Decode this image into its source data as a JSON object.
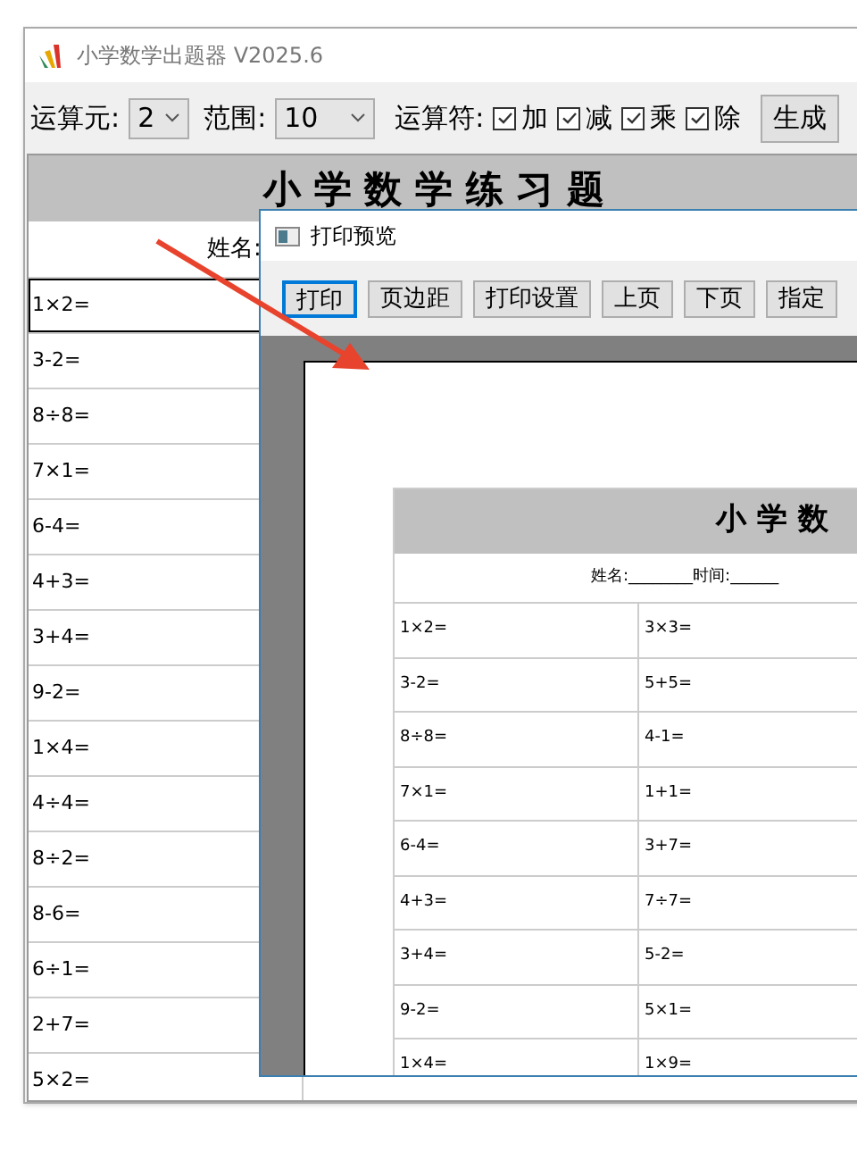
{
  "window": {
    "title": "小学数学出题器 V2025.6"
  },
  "toolbar": {
    "operand_count": {
      "label": "运算元:",
      "value": "2"
    },
    "range": {
      "label": "范围:",
      "value": "10"
    },
    "operators_label": "运算符:",
    "operators": [
      {
        "label": "加",
        "checked": true
      },
      {
        "label": "减",
        "checked": true
      },
      {
        "label": "乘",
        "checked": true
      },
      {
        "label": "除",
        "checked": true
      }
    ],
    "generate_button": "生成"
  },
  "sheet": {
    "title": "小 学 数 学 练 习 题",
    "name_label": "姓名:",
    "rows": [
      {
        "selected": true,
        "cells": [
          "1×2="
        ]
      },
      {
        "selected": false,
        "cells": [
          "3-2="
        ]
      },
      {
        "selected": false,
        "cells": [
          "8÷8="
        ]
      },
      {
        "selected": false,
        "cells": [
          "7×1="
        ]
      },
      {
        "selected": false,
        "cells": [
          "6-4="
        ]
      },
      {
        "selected": false,
        "cells": [
          "4+3="
        ]
      },
      {
        "selected": false,
        "cells": [
          "3+4="
        ]
      },
      {
        "selected": false,
        "cells": [
          "9-2="
        ]
      },
      {
        "selected": false,
        "cells": [
          "1×4="
        ]
      },
      {
        "selected": false,
        "cells": [
          "4÷4="
        ]
      },
      {
        "selected": false,
        "cells": [
          "8÷2="
        ]
      },
      {
        "selected": false,
        "cells": [
          "8-6="
        ]
      },
      {
        "selected": false,
        "cells": [
          "6÷1="
        ]
      },
      {
        "selected": false,
        "cells": [
          "2+7="
        ]
      },
      {
        "selected": false,
        "cells": [
          "5×2="
        ]
      }
    ]
  },
  "print_preview": {
    "title": "打印预览",
    "buttons": [
      {
        "label": "打印",
        "selected": true
      },
      {
        "label": "页边距",
        "selected": false
      },
      {
        "label": "打印设置",
        "selected": false
      },
      {
        "label": "上页",
        "selected": false
      },
      {
        "label": "下页",
        "selected": false
      },
      {
        "label": "指定",
        "selected": false
      }
    ],
    "page": {
      "title": "小 学 数",
      "name_line": "姓名:________时间:______",
      "rows": [
        [
          "1×2=",
          "3×3="
        ],
        [
          "3-2=",
          "5+5="
        ],
        [
          "8÷8=",
          "4-1="
        ],
        [
          "7×1=",
          "1+1="
        ],
        [
          "6-4=",
          "3+7="
        ],
        [
          "4+3=",
          "7÷7="
        ],
        [
          "3+4=",
          "5-2="
        ],
        [
          "9-2=",
          "5×1="
        ],
        [
          "1×4=",
          "1×9="
        ]
      ]
    }
  }
}
